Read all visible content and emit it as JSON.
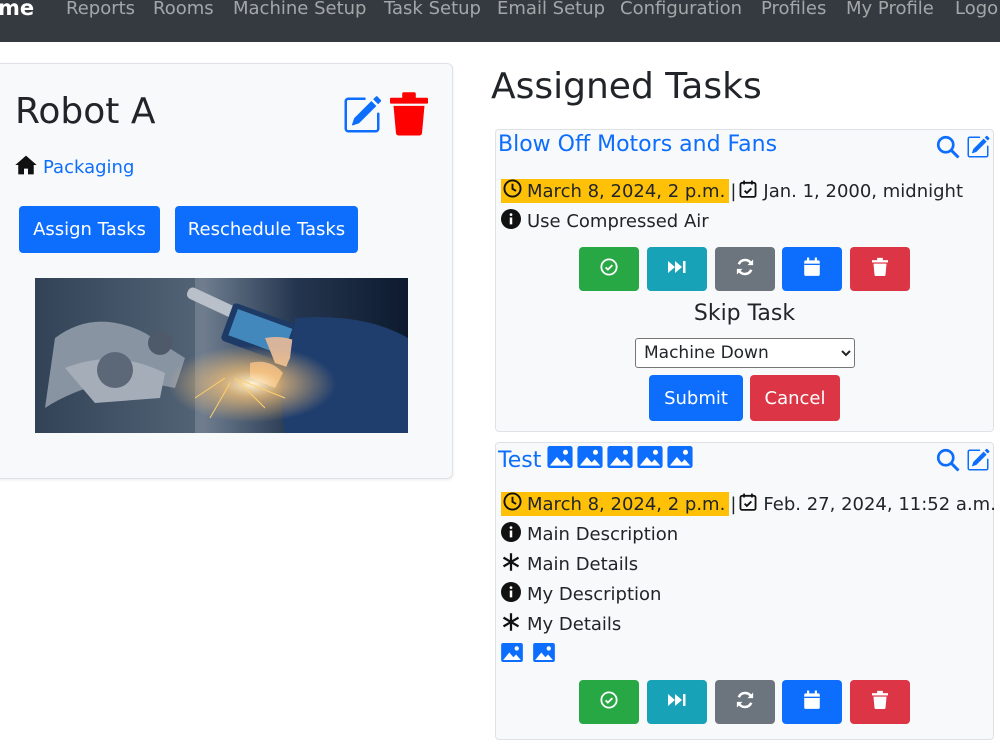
{
  "nav": {
    "brand": "me",
    "items": [
      "Reports",
      "Rooms",
      "Machine Setup",
      "Task Setup",
      "Email Setup",
      "Configuration",
      "Profiles",
      "My Profile",
      "Logo"
    ]
  },
  "machine": {
    "name": "Robot A",
    "room": "Packaging",
    "assign_label": "Assign Tasks",
    "reschedule_label": "Reschedule Tasks"
  },
  "assigned": {
    "title": "Assigned Tasks",
    "tasks": [
      {
        "name": "Blow Off Motors and Fans",
        "due": "March 8, 2024, 2 p.m.",
        "completed": "Jan. 1, 2000, midnight",
        "description": "Use Compressed Air",
        "skip": {
          "heading": "Skip Task",
          "selected": "Machine Down",
          "submit": "Submit",
          "cancel": "Cancel"
        }
      },
      {
        "name": "Test",
        "due": "March 8, 2024, 2 p.m.",
        "completed": "Feb. 27, 2024, 11:52 a.m.",
        "lines": [
          "Main Description",
          "Main Details",
          "My Description",
          "My Details"
        ]
      }
    ]
  },
  "colors": {
    "navbar": "#343a40",
    "primary": "#0d6efd",
    "danger": "#dc3545",
    "success": "#28a745",
    "info": "#17a2b8",
    "secondary": "#6c757d",
    "warning": "#ffc107"
  },
  "icons": {
    "edit": "pencil-square-icon",
    "delete": "trash-icon",
    "room": "house-icon",
    "search": "search-icon",
    "due": "clock-icon",
    "completed": "calendar-check-icon",
    "description": "info-circle-icon",
    "details": "asterisk-icon",
    "image": "image-icon",
    "complete_action": "check-circle-icon",
    "skip_action": "skip-forward-icon",
    "reassign_action": "arrow-repeat-icon",
    "reschedule_action": "calendar-icon"
  }
}
